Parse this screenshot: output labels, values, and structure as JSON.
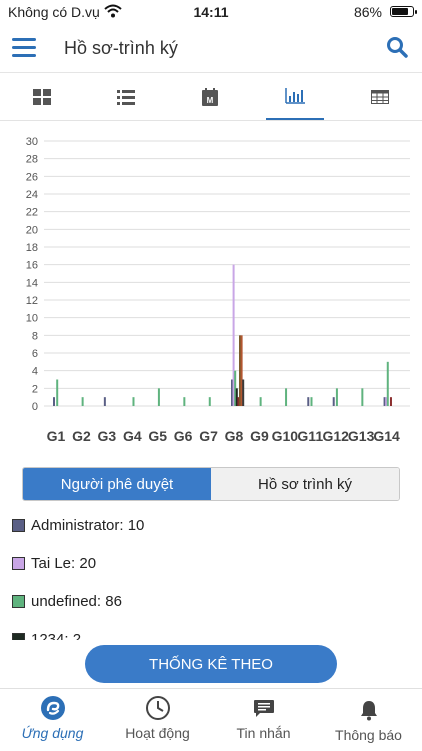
{
  "status_bar": {
    "carrier": "Không có D.vụ",
    "time": "14:11",
    "battery": "86%",
    "battery_level": 0.86
  },
  "header": {
    "title": "Hồ sơ-trình ký",
    "icons": [
      "menu-icon",
      "search-icon"
    ]
  },
  "tabs": [
    {
      "icon": "grid-icon",
      "active": false
    },
    {
      "icon": "list-icon",
      "active": false
    },
    {
      "icon": "calendar-icon",
      "active": false,
      "glyph": "M"
    },
    {
      "icon": "bar-chart-icon",
      "active": true
    },
    {
      "icon": "table-icon",
      "active": false
    }
  ],
  "chart_data": {
    "type": "bar",
    "categories": [
      "G1",
      "G2",
      "G3",
      "G4",
      "G5",
      "G6",
      "G7",
      "G8",
      "G9",
      "G10",
      "G11",
      "G12",
      "G13",
      "G14"
    ],
    "y_ticks": [
      0,
      2,
      4,
      6,
      8,
      10,
      12,
      14,
      16,
      18,
      20,
      22,
      24,
      26,
      28,
      30
    ],
    "ylim": [
      0,
      30
    ],
    "grid": true,
    "series": [
      {
        "name": "Administrator",
        "color": "#5a5f85",
        "values": [
          1,
          0,
          1,
          0,
          0,
          0,
          0,
          3,
          0,
          0,
          1,
          1,
          0,
          1
        ]
      },
      {
        "name": "Tai Le",
        "color": "#c9a6e6",
        "values": [
          0,
          0,
          0,
          0,
          0,
          0,
          0,
          16,
          0,
          0,
          0,
          0,
          0,
          1
        ]
      },
      {
        "name": "undefined",
        "color": "#5fb37e",
        "values": [
          3,
          1,
          0,
          1,
          2,
          1,
          1,
          4,
          1,
          2,
          1,
          2,
          2,
          5
        ]
      },
      {
        "name": "1234",
        "color": "#1e2a22",
        "values": [
          0,
          0,
          0,
          0,
          0,
          0,
          0,
          2,
          0,
          0,
          0,
          0,
          0,
          0
        ]
      },
      {
        "name": "",
        "color": "#8b2e2e",
        "values": [
          0,
          0,
          0,
          0,
          0,
          0,
          0,
          1,
          0,
          0,
          0,
          0,
          0,
          1
        ]
      },
      {
        "name": "",
        "color": "#7a5a2a",
        "values": [
          0,
          0,
          0,
          0,
          0,
          0,
          0,
          8,
          0,
          0,
          0,
          0,
          0,
          0
        ]
      },
      {
        "name": "",
        "color": "#b25630",
        "values": [
          0,
          0,
          0,
          0,
          0,
          0,
          0,
          8,
          0,
          0,
          0,
          0,
          0,
          0
        ]
      },
      {
        "name": "",
        "color": "#3a3a3a",
        "values": [
          0,
          0,
          0,
          0,
          0,
          0,
          0,
          3,
          0,
          0,
          0,
          0,
          0,
          0
        ]
      }
    ]
  },
  "segmented": {
    "option1": "Người phê duyệt",
    "option2": "Hồ sơ trình ký"
  },
  "legend": [
    {
      "label": "Administrator: 10",
      "color": "#5a5f85"
    },
    {
      "label": "Tai Le: 20",
      "color": "#c9a6e6"
    },
    {
      "label": "undefined: 86",
      "color": "#5fb37e"
    },
    {
      "label": "1234: 2",
      "color": "#1e2a22"
    }
  ],
  "stat_button": "THỐNG KÊ THEO",
  "bottom_nav": [
    {
      "label": "Ứng dụng",
      "icon": "app-icon",
      "active": true
    },
    {
      "label": "Hoạt động",
      "icon": "clock-icon",
      "active": false
    },
    {
      "label": "Tin nhắn",
      "icon": "message-icon",
      "active": false
    },
    {
      "label": "Thông báo",
      "icon": "bell-icon",
      "active": false
    }
  ]
}
